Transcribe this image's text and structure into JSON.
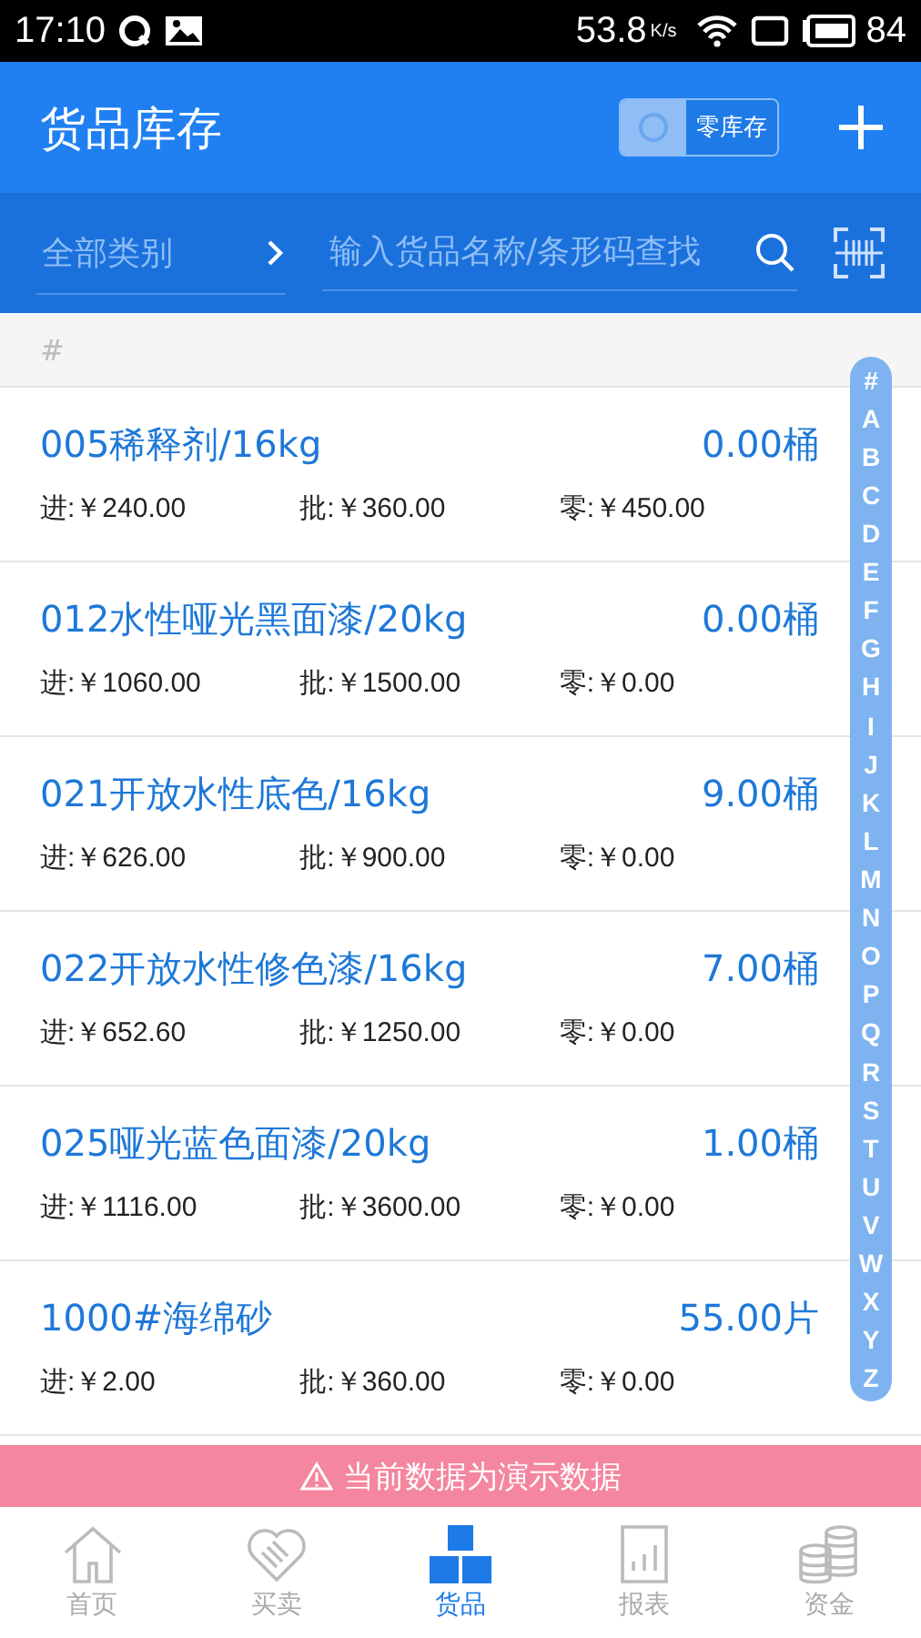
{
  "status_bar": {
    "time": "17:10",
    "speed": "53.8",
    "speed_unit": "K/s",
    "battery": "84"
  },
  "header": {
    "title": "货品库存",
    "zero_stock_toggle": {
      "label": "零库存",
      "on": false
    }
  },
  "filter": {
    "category": "全部类别",
    "search": {
      "placeholder": "输入货品名称/条形码查找"
    }
  },
  "section": "#",
  "items": [
    {
      "name": "005稀释剂/16kg",
      "quantity": "0.00桶",
      "cost": "进:￥240.00",
      "wholesale": "批:￥360.00",
      "retail": "零:￥450.00"
    },
    {
      "name": "012水性哑光黑面漆/20kg",
      "quantity": "0.00桶",
      "cost": "进:￥1060.00",
      "wholesale": "批:￥1500.00",
      "retail": "零:￥0.00"
    },
    {
      "name": "021开放水性底色/16kg",
      "quantity": "9.00桶",
      "cost": "进:￥626.00",
      "wholesale": "批:￥900.00",
      "retail": "零:￥0.00"
    },
    {
      "name": "022开放水性修色漆/16kg",
      "quantity": "7.00桶",
      "cost": "进:￥652.60",
      "wholesale": "批:￥1250.00",
      "retail": "零:￥0.00"
    },
    {
      "name": "025哑光蓝色面漆/20kg",
      "quantity": "1.00桶",
      "cost": "进:￥1116.00",
      "wholesale": "批:￥3600.00",
      "retail": "零:￥0.00"
    },
    {
      "name": "1000#海绵砂",
      "quantity": "55.00片",
      "cost": "进:￥2.00",
      "wholesale": "批:￥360.00",
      "retail": "零:￥0.00"
    }
  ],
  "index_letters": [
    "#",
    "A",
    "B",
    "C",
    "D",
    "E",
    "F",
    "G",
    "H",
    "I",
    "J",
    "K",
    "L",
    "M",
    "N",
    "O",
    "P",
    "Q",
    "R",
    "S",
    "T",
    "U",
    "V",
    "W",
    "X",
    "Y",
    "Z"
  ],
  "demo_banner": "当前数据为演示数据",
  "tabs": [
    {
      "label": "首页",
      "kind": "home",
      "selected": false
    },
    {
      "label": "买卖",
      "kind": "deal",
      "selected": false
    },
    {
      "label": "货品",
      "kind": "goods",
      "selected": true
    },
    {
      "label": "报表",
      "kind": "report",
      "selected": false
    },
    {
      "label": "资金",
      "kind": "money",
      "selected": false
    }
  ]
}
